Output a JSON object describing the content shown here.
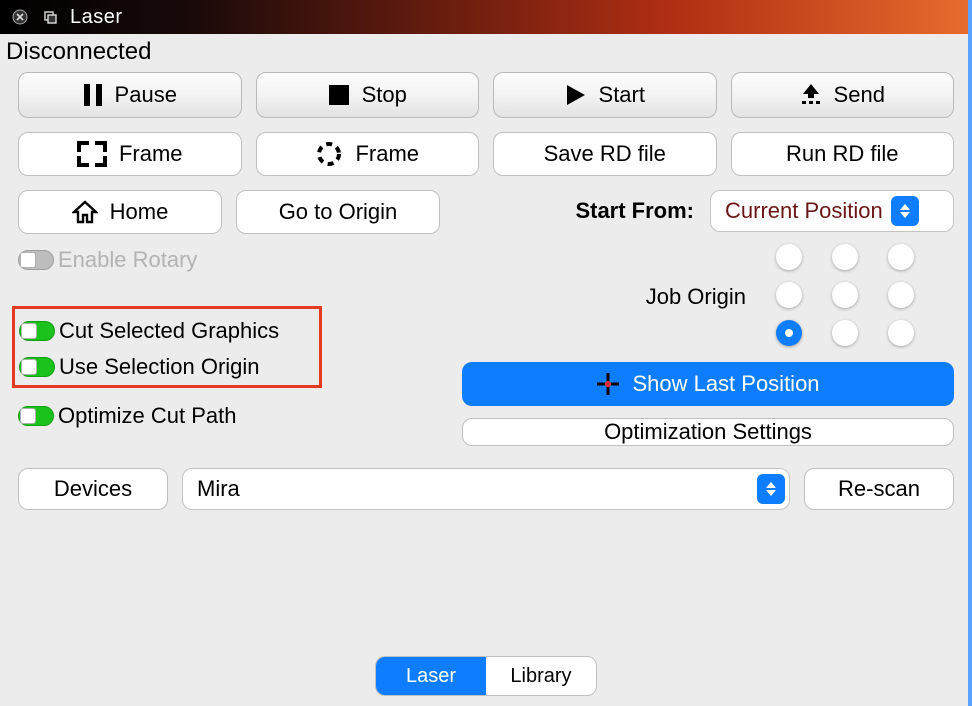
{
  "window": {
    "title": "Laser",
    "status": "Disconnected"
  },
  "toolbar": {
    "pause": "Pause",
    "stop": "Stop",
    "start": "Start",
    "send": "Send",
    "frame_solid": "Frame",
    "frame_dashed": "Frame",
    "save_rd": "Save RD file",
    "run_rd": "Run RD file"
  },
  "controls": {
    "home": "Home",
    "go_origin": "Go to Origin",
    "start_from_label": "Start From:",
    "start_from_value": "Current Position",
    "enable_rotary": "Enable Rotary",
    "cut_selected": "Cut Selected Graphics",
    "use_selection_origin": "Use Selection Origin",
    "optimize_cut_path": "Optimize Cut Path",
    "job_origin": "Job Origin",
    "job_origin_selected": 6,
    "show_last_position": "Show Last Position",
    "optimization_settings": "Optimization Settings"
  },
  "devices": {
    "button": "Devices",
    "selected": "Mira",
    "rescan": "Re-scan"
  },
  "tabs": {
    "active": "Laser",
    "items": [
      "Laser",
      "Library"
    ]
  }
}
